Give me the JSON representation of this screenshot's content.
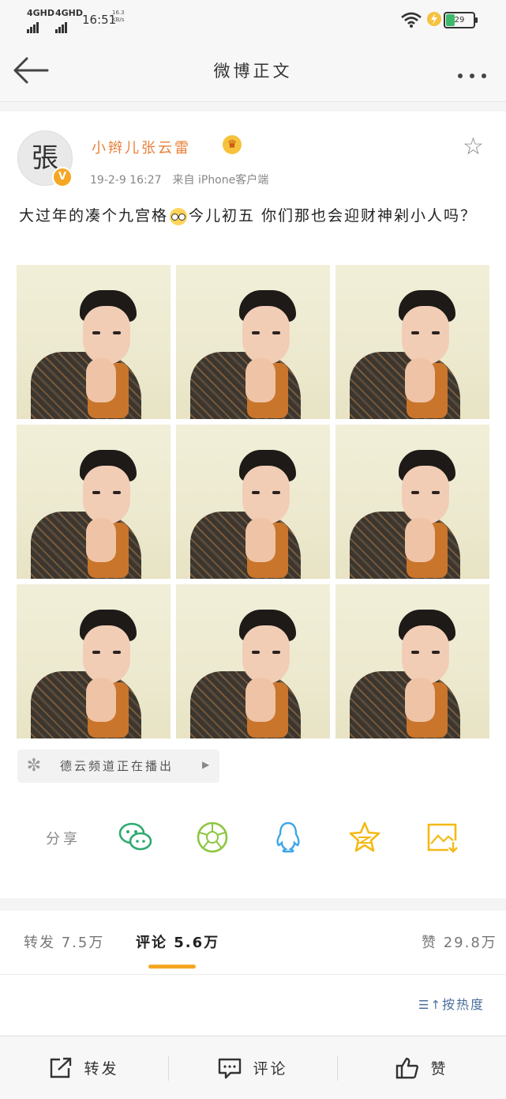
{
  "status_bar": {
    "network1": "4GHD",
    "network2": "4GHD",
    "time": "16:51",
    "speed_value": "16.3",
    "speed_unit": "KB/s",
    "battery": "29"
  },
  "nav": {
    "title": "微博正文",
    "back_icon": "back-arrow-icon",
    "more_icon": "more-dots-icon"
  },
  "post": {
    "avatar_text": "張",
    "username": "小辫儿张云雷",
    "time": "19-2-9 16:27",
    "source": "来自 iPhone客户端",
    "text_before_emoji": "大过年的凑个九宫格",
    "text_after_emoji": "今儿初五 你们那也会迎财神剁小人吗？",
    "photo_count": 9
  },
  "channel": {
    "label": "德云频道正在播出"
  },
  "share": {
    "label": "分享",
    "targets": [
      "wechat-icon",
      "moments-icon",
      "qq-icon",
      "qzone-icon",
      "save-image-icon"
    ]
  },
  "tabs": {
    "repost": "转发 7.5万",
    "comment": "评论 5.6万",
    "like": "赞 29.8万"
  },
  "sort": {
    "label": "按热度"
  },
  "bottom_bar": {
    "repost": "转发",
    "comment": "评论",
    "like": "赞"
  },
  "colors": {
    "accent": "#f5a623",
    "username": "#e8803a",
    "link": "#4a6f9c"
  }
}
